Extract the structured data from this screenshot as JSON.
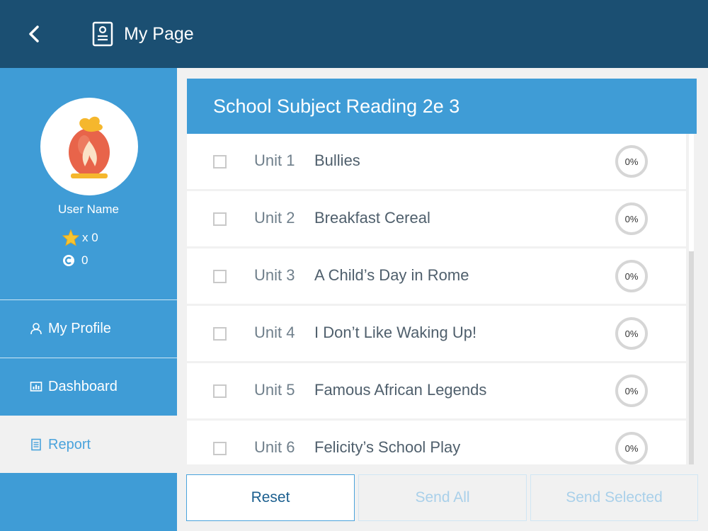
{
  "header": {
    "title": "My Page",
    "back_icon": "chevron-left-icon",
    "title_icon": "document-icon"
  },
  "sidebar": {
    "user_name": "User Name",
    "stars_label": "x 0",
    "coins_label": "0",
    "nav": [
      {
        "label": "My Profile",
        "icon": "person-icon"
      },
      {
        "label": "Dashboard",
        "icon": "chart-icon"
      },
      {
        "label": "Report",
        "icon": "report-icon",
        "active": true
      }
    ]
  },
  "book": {
    "title": "School Subject Reading 2e 3"
  },
  "units": [
    {
      "num": "Unit 1",
      "title": "Bullies",
      "progress": "0%",
      "checked": false
    },
    {
      "num": "Unit 2",
      "title": "Breakfast Cereal",
      "progress": "0%",
      "checked": false
    },
    {
      "num": "Unit 3",
      "title": "A Child’s Day in Rome",
      "progress": "0%",
      "checked": false
    },
    {
      "num": "Unit 4",
      "title": "I Don’t Like Waking Up!",
      "progress": "0%",
      "checked": false
    },
    {
      "num": "Unit 5",
      "title": "Famous African Legends",
      "progress": "0%",
      "checked": false
    },
    {
      "num": "Unit 6",
      "title": "Felicity’s School Play",
      "progress": "0%",
      "checked": false
    }
  ],
  "buttons": {
    "reset": "Reset",
    "send_all": "Send All",
    "send_selected": "Send Selected"
  },
  "colors": {
    "header_bg": "#1b4f72",
    "accent": "#3f9cd6",
    "background": "#f1f1f1"
  }
}
